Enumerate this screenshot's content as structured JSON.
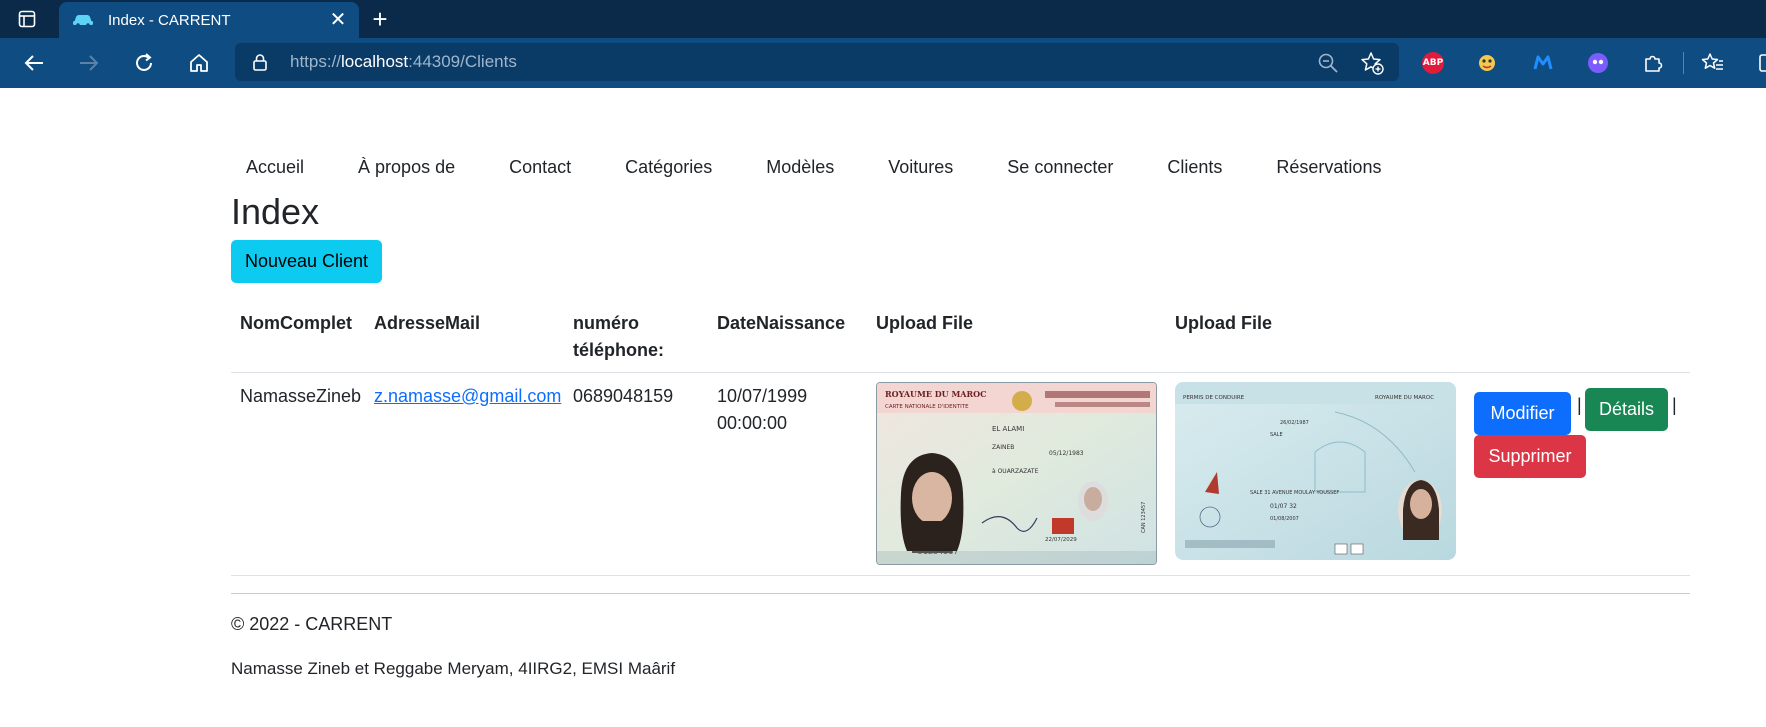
{
  "browser": {
    "tab_title": "Index - CARRENT",
    "url_scheme": "https://",
    "url_host": "localhost",
    "url_rest": ":44309/Clients",
    "extensions": {
      "abp_label": "ABP"
    }
  },
  "nav": {
    "items": [
      {
        "label": "Accueil"
      },
      {
        "label": "À propos de"
      },
      {
        "label": "Contact"
      },
      {
        "label": "Catégories"
      },
      {
        "label": "Modèles"
      },
      {
        "label": "Voitures"
      },
      {
        "label": "Se connecter"
      },
      {
        "label": "Clients"
      },
      {
        "label": "Réservations"
      }
    ]
  },
  "page": {
    "title": "Index",
    "new_button": "Nouveau Client"
  },
  "table": {
    "headers": [
      "NomComplet",
      "AdresseMail",
      "numéro",
      "téléphone:",
      "DateNaissance",
      "Upload File",
      "Upload File"
    ],
    "rows": [
      {
        "nom": "NamasseZineb",
        "email": "z.namasse@gmail.com",
        "telephone": "0689048159",
        "date_line1": "10/07/1999",
        "date_line2": "00:00:00",
        "modifier": "Modifier",
        "details": "Détails",
        "supprimer": "Supprimer",
        "separator": "|"
      }
    ]
  },
  "id_card": {
    "header_left": "ROYAUME DU MAROC",
    "header_sub": "CARTE NATIONALE D'IDENTITE",
    "name": "EL ALAMI",
    "first": "ZAINEB",
    "date": "05/12/1983",
    "place": "à OUARZAZATE",
    "number": "U1234567",
    "validity": "22/07/2029",
    "can": "CAN 123457"
  },
  "license": {
    "header_left": "PERMIS DE CONDUIRE",
    "header_right": "ROYAUME DU MAROC",
    "date": "26/02/1987",
    "city": "SALE",
    "address": "SALE 31 AVENUE MOULAY YOUSSEF",
    "permis_no": "01/07 32",
    "rabat": "01/08/2007"
  },
  "footer": {
    "copyright": "© 2022 - CARRENT",
    "credits": "Namasse Zineb et Reggabe Meryam, 4IIRG2, EMSI Maârif"
  },
  "colors": {
    "primary": "#0d6efd",
    "info": "#0dcaf0",
    "success": "#198754",
    "danger": "#dc3545",
    "chrome_dark": "#0b2a4a",
    "chrome": "#0f4c81"
  }
}
